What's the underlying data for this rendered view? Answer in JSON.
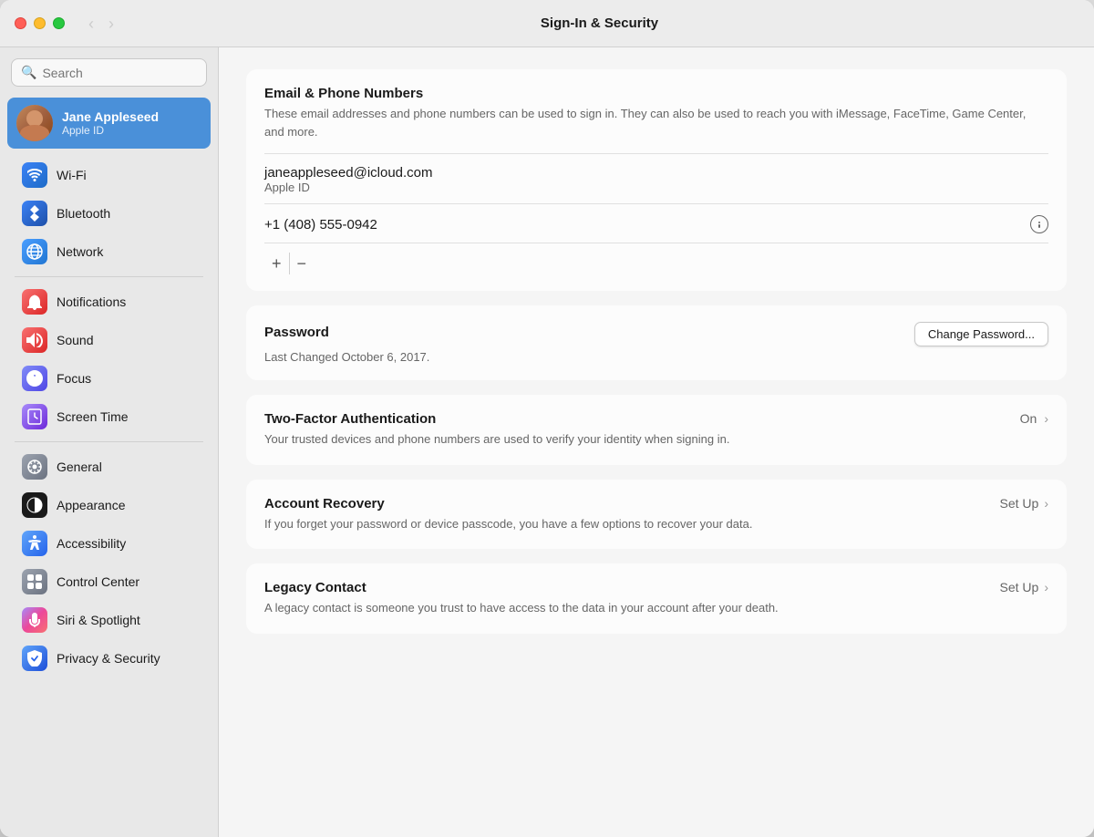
{
  "window": {
    "title": "Sign-In & Security"
  },
  "titlebar": {
    "back_label": "‹",
    "forward_label": "›",
    "title": "Sign-In & Security"
  },
  "sidebar": {
    "search_placeholder": "Search",
    "profile": {
      "name": "Jane Appleseed",
      "subtitle": "Apple ID"
    },
    "items": [
      {
        "id": "wifi",
        "label": "Wi-Fi",
        "icon_class": "icon-wifi",
        "icon_char": "📶"
      },
      {
        "id": "bluetooth",
        "label": "Bluetooth",
        "icon_class": "icon-bluetooth",
        "icon_char": "⬡"
      },
      {
        "id": "network",
        "label": "Network",
        "icon_class": "icon-network",
        "icon_char": "🌐"
      },
      {
        "id": "notifications",
        "label": "Notifications",
        "icon_class": "icon-notifications",
        "icon_char": "🔔"
      },
      {
        "id": "sound",
        "label": "Sound",
        "icon_class": "icon-sound",
        "icon_char": "🔊"
      },
      {
        "id": "focus",
        "label": "Focus",
        "icon_class": "icon-focus",
        "icon_char": "🌙"
      },
      {
        "id": "screentime",
        "label": "Screen Time",
        "icon_class": "icon-screentime",
        "icon_char": "⏱"
      },
      {
        "id": "general",
        "label": "General",
        "icon_class": "icon-general",
        "icon_char": "⚙"
      },
      {
        "id": "appearance",
        "label": "Appearance",
        "icon_class": "icon-appearance",
        "icon_char": "◑"
      },
      {
        "id": "accessibility",
        "label": "Accessibility",
        "icon_class": "icon-accessibility",
        "icon_char": "♿"
      },
      {
        "id": "controlcenter",
        "label": "Control Center",
        "icon_class": "icon-controlcenter",
        "icon_char": "▤"
      },
      {
        "id": "siri",
        "label": "Siri & Spotlight",
        "icon_class": "icon-siri",
        "icon_char": "◉"
      },
      {
        "id": "privacy",
        "label": "Privacy & Security",
        "icon_class": "icon-privacy",
        "icon_char": "✋"
      }
    ]
  },
  "main": {
    "email_section": {
      "title": "Email & Phone Numbers",
      "description": "These email addresses and phone numbers can be used to sign in. They can also be used to reach you with iMessage, FaceTime, Game Center, and more.",
      "email": "janeappleseed@icloud.com",
      "email_type": "Apple ID",
      "phone": "+1 (408) 555-0942",
      "add_label": "+",
      "remove_label": "−"
    },
    "password_section": {
      "title": "Password",
      "last_changed": "Last Changed October 6, 2017.",
      "change_btn_label": "Change Password..."
    },
    "two_factor_section": {
      "title": "Two-Factor Authentication",
      "status": "On",
      "description": "Your trusted devices and phone numbers are used to verify your identity when signing in."
    },
    "account_recovery_section": {
      "title": "Account Recovery",
      "status": "Set Up",
      "description": "If you forget your password or device passcode, you have a few options to recover your data."
    },
    "legacy_contact_section": {
      "title": "Legacy Contact",
      "status": "Set Up",
      "description": "A legacy contact is someone you trust to have access to the data in your account after your death."
    }
  }
}
